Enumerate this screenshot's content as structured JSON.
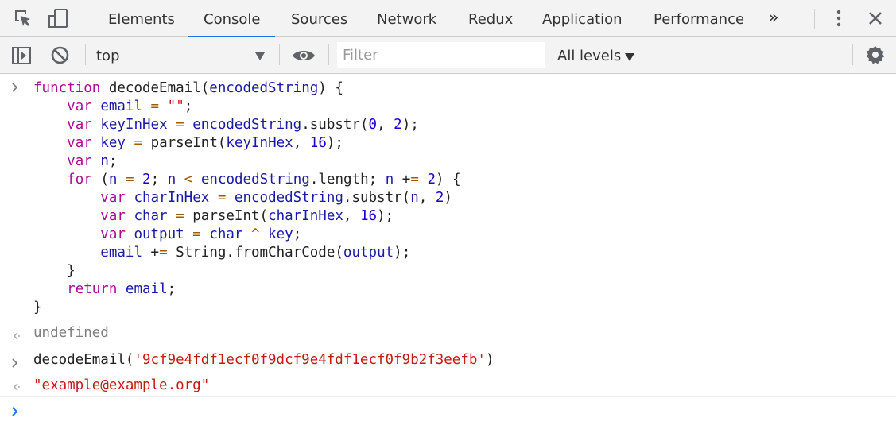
{
  "tabs": [
    {
      "label": "Elements"
    },
    {
      "label": "Console"
    },
    {
      "label": "Sources"
    },
    {
      "label": "Network"
    },
    {
      "label": "Redux"
    },
    {
      "label": "Application"
    },
    {
      "label": "Performance"
    }
  ],
  "tabs_active": "Console",
  "overflow_label": "»",
  "toolbar": {
    "context": "top",
    "filter_placeholder": "Filter",
    "levels": "All levels"
  },
  "icons": {
    "inspect": "inspect-element-icon",
    "device": "device-toggle-icon",
    "more": "more-vertical-icon",
    "close": "close-icon",
    "sidebar": "sidebar-toggle-icon",
    "clear": "clear-console-icon",
    "eye": "live-expression-icon",
    "settings": "gear-icon"
  },
  "colors": {
    "keyword": "#aa0d91",
    "variable": "#1a1aa6",
    "string": "#c41a16",
    "number": "#1c00cf",
    "accent": "#1a73e8"
  },
  "console": {
    "code_lines": [
      "function decodeEmail(encodedString) {",
      "    var email = \"\";",
      "    var keyInHex = encodedString.substr(0, 2);",
      "    var key = parseInt(keyInHex, 16);",
      "    var n;",
      "    for (n = 2; n < encodedString.length; n += 2) {",
      "        var charInHex = encodedString.substr(n, 2)",
      "        var char = parseInt(charInHex, 16);",
      "        var output = char ^ key;",
      "        email += String.fromCharCode(output);",
      "    }",
      "    return email;",
      "}"
    ],
    "result1": "undefined",
    "call_fn": "decodeEmail(",
    "call_arg": "'9cf9e4fdf1ecf0f9dcf9e4fdf1ecf0f9b2f3eefb'",
    "call_close": ")",
    "result2": "\"example@example.org\""
  }
}
